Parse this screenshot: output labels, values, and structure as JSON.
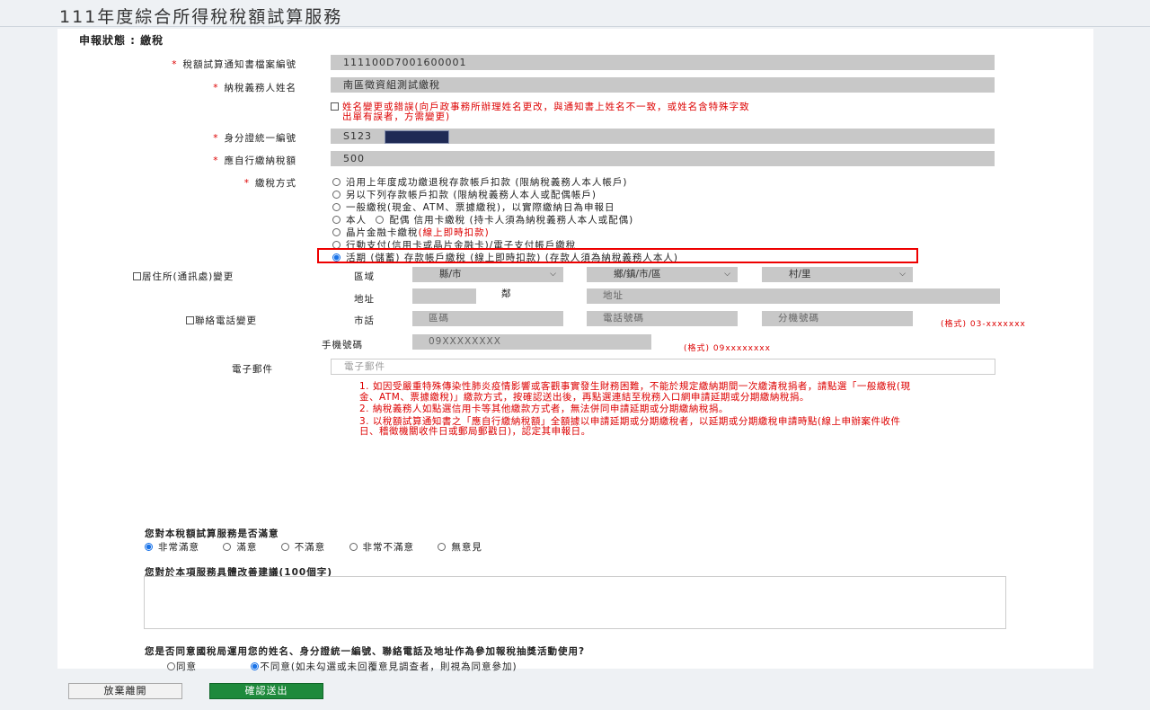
{
  "page_title": "111年度綜合所得稅稅額試算服務",
  "status": "申報狀態 : 繳稅",
  "fields": {
    "notice_no_label": "稅額試算通知書檔案編號",
    "notice_no_value": "111100D7001600001",
    "name_label": "納稅義務人姓名",
    "name_value": "南區徵資組測試繳稅",
    "name_change_text_1": "姓名變更或錯誤(向戶政事務所辦理姓名更改，與通知書上姓名不一致，或姓名含特殊字致",
    "name_change_text_2": "出單有誤者，方需變更)",
    "id_label": "身分證統一編號",
    "id_value": "S123",
    "amount_label": "應自行繳納稅額",
    "amount_value": "500",
    "pay_method_label": "繳稅方式"
  },
  "pay_options": {
    "o1": "沿用上年度成功繳退稅存款帳戶扣款 (限納稅義務人本人帳戶)",
    "o2": "另以下列存款帳戶扣款 (限納稅義務人本人或配偶帳戶)",
    "o3": "一般繳稅(現金、ATM、票據繳稅)，以實際繳納日為申報日",
    "o4a": "本人",
    "o4b": "配偶 信用卡繳稅 (持卡人須為納稅義務人本人或配偶)",
    "o5a": "晶片金融卡繳稅",
    "o5b": "(線上即時扣款)",
    "o6": "行動支付(信用卡或晶片金融卡)/電子支付帳戶繳稅",
    "o7": "活期 (儲蓄) 存款帳戶繳稅 (線上即時扣款) (存款人須為納稅義務人本人)"
  },
  "address": {
    "label": "居住所(通訊處)變更",
    "region_label": "區域",
    "county": "縣/市",
    "town": "鄉/鎮/市/區",
    "village": "村/里",
    "addr_label": "地址",
    "neighbor": "鄰",
    "addr_placeholder": "地址"
  },
  "phone": {
    "label": "聯絡電話變更",
    "tel_label": "市話",
    "area_placeholder": "區碼",
    "tel_placeholder": "電話號碼",
    "ext_placeholder": "分機號碼",
    "tel_format": "(格式) 03-xxxxxxx",
    "mobile_label": "手機號碼",
    "mobile_placeholder": "09XXXXXXXX",
    "mobile_format": "(格式) 09xxxxxxxx"
  },
  "email": {
    "label": "電子郵件",
    "placeholder": "電子郵件"
  },
  "notes": [
    "1. 如因受嚴重特殊傳染性肺炎疫情影響或客觀事實發生財務困難，不能於規定繳納期間一次繳清稅捐者，請點選「一般繳稅(現金、ATM、票據繳稅)」繳款方式，按確認送出後，再點選連結至稅務入口網申請延期或分期繳納稅捐。",
    "2. 納稅義務人如點選信用卡等其他繳款方式者，無法併同申請延期或分期繳納稅捐。",
    "3. 以稅額試算通知書之「應自行繳納稅額」全額據以申請延期或分期繳稅者，以延期或分期繳稅申請時點(線上申辦案件收件日、稽徵機關收件日或郵局郵戳日)，認定其申報日。"
  ],
  "survey": {
    "q1": "您對本稅額試算服務是否滿意",
    "a1": "非常滿意",
    "a2": "滿意",
    "a3": "不滿意",
    "a4": "非常不滿意",
    "a5": "無意見",
    "q2": "您對於本項服務具體改善建議(100個字)",
    "q3": "您是否同意國稅局運用您的姓名、身分證統一編號、聯絡電話及地址作為參加報稅抽獎活動使用?",
    "agree": "同意",
    "disagree": "不同意(如未勾選或未回覆意見調查者，則視為同意參加)"
  },
  "buttons": {
    "cancel": "放棄離開",
    "submit": "確認送出"
  },
  "colors": {
    "required": "#d00000",
    "highlight_border": "#e00000",
    "submit_bg": "#1e8a3c"
  }
}
